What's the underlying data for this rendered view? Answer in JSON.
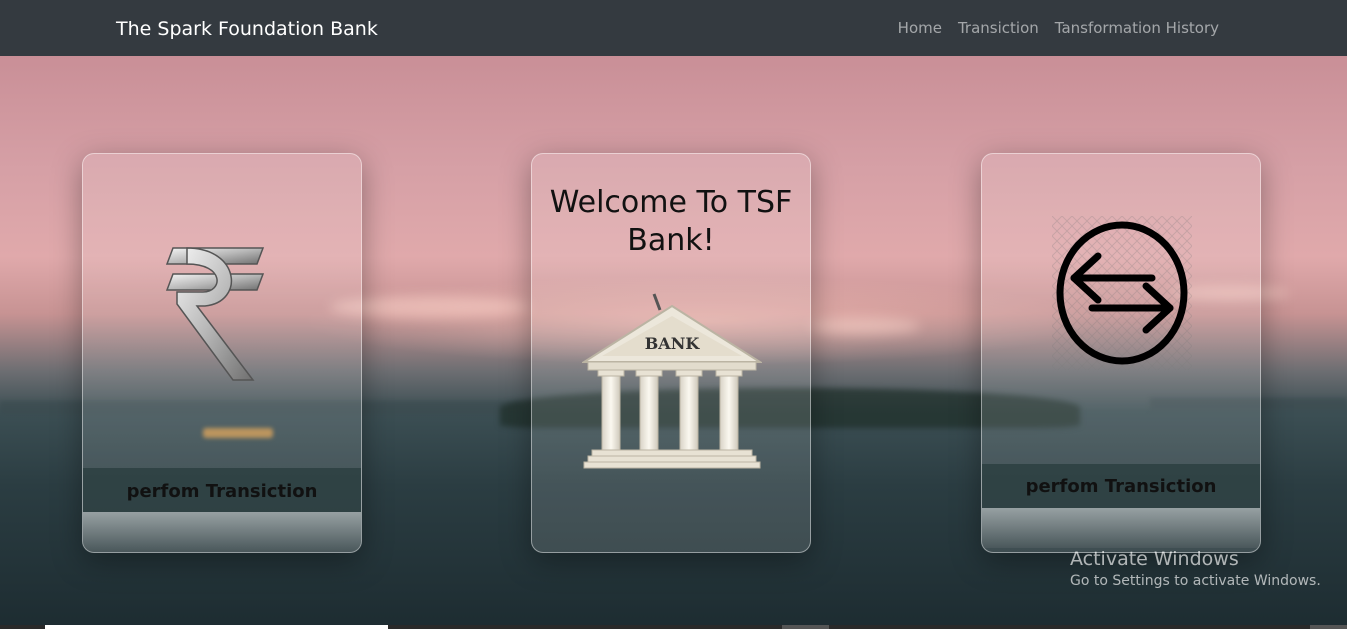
{
  "navbar": {
    "brand": "The Spark Foundation Bank",
    "links": [
      "Home",
      "Transiction",
      "Tansformation History"
    ],
    "background": "#343a40"
  },
  "cards": {
    "left": {
      "icon": "rupee-icon",
      "label": "perfom Transiction"
    },
    "center": {
      "title": "Welcome To TSF Bank!",
      "icon": "bank-building-icon",
      "bank_sign": "BANK"
    },
    "right": {
      "icon": "transfer-arrows-icon",
      "label": "perfom Transiction"
    }
  },
  "watermark": {
    "title": "Activate Windows",
    "subtitle": "Go to Settings to activate Windows."
  }
}
